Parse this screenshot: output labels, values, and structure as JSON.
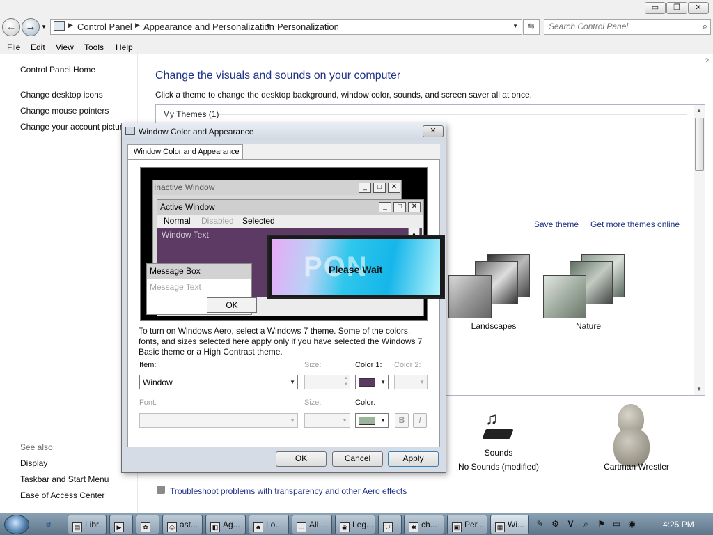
{
  "window": {
    "caption_buttons": {
      "minimize": "▭",
      "maximize": "❐",
      "close": "✕"
    },
    "address": {
      "crumbs": [
        "Control Panel",
        "Appearance and Personalization",
        "Personalization"
      ],
      "search_placeholder": "Search Control Panel"
    },
    "menu": [
      "File",
      "Edit",
      "View",
      "Tools",
      "Help"
    ]
  },
  "left_nav": {
    "home": "Control Panel Home",
    "links": [
      "Change desktop icons",
      "Change mouse pointers",
      "Change your account picture"
    ],
    "see_also_label": "See also",
    "see_also": [
      "Display",
      "Taskbar and Start Menu",
      "Ease of Access Center"
    ]
  },
  "main": {
    "title": "Change the visuals and sounds on your computer",
    "description": "Click a theme to change the desktop background, window color, sounds, and screen saver all at once.",
    "my_themes": "My Themes (1)",
    "save_theme": "Save theme",
    "get_more": "Get more themes online",
    "themes": [
      {
        "name": "Landscapes"
      },
      {
        "name": "Nature"
      }
    ],
    "sounds_label": "Sounds",
    "sounds_value": "No Sounds (modified)",
    "screensaver_label": "Cartman Wrestler",
    "troubleshoot": "Troubleshoot problems with transparency and other Aero effects"
  },
  "dialog": {
    "title": "Window Color and Appearance",
    "tab": "Window Color and Appearance",
    "preview": {
      "inactive": "Inactive Window",
      "active": "Active Window",
      "menu_normal": "Normal",
      "menu_disabled": "Disabled",
      "menu_selected": "Selected",
      "window_text": "Window Text",
      "message_box": "Message Box",
      "message_text": "Message Text",
      "ok": "OK"
    },
    "please_wait": "Please Wait",
    "please_wait_deco": "PON",
    "info": "To turn on Windows Aero, select a Windows 7 theme.  Some of the colors, fonts, and sizes selected here apply only if you have selected the Windows 7 Basic theme or a High Contrast theme.",
    "item_label": "Item:",
    "item_value": "Window",
    "size_label": "Size:",
    "color1_label": "Color 1:",
    "color1": "#5c3a64",
    "color2_label": "Color 2:",
    "font_label": "Font:",
    "font_size_label": "Size:",
    "color_label": "Color:",
    "font_color": "#9ab59a",
    "bold": "B",
    "italic": "I",
    "buttons": {
      "ok": "OK",
      "cancel": "Cancel",
      "apply": "Apply"
    }
  },
  "taskbar": {
    "tasks": [
      "Libr...",
      "ast...",
      "Ag...",
      "Lo...",
      "All ...",
      "Leg...",
      "ch...",
      "Per...",
      "Wi..."
    ],
    "clock": "4:25 PM"
  },
  "colors": {
    "link_blue": "#1e3287",
    "preview_client": "#5c3a64",
    "taskbar": "#6f8599"
  }
}
